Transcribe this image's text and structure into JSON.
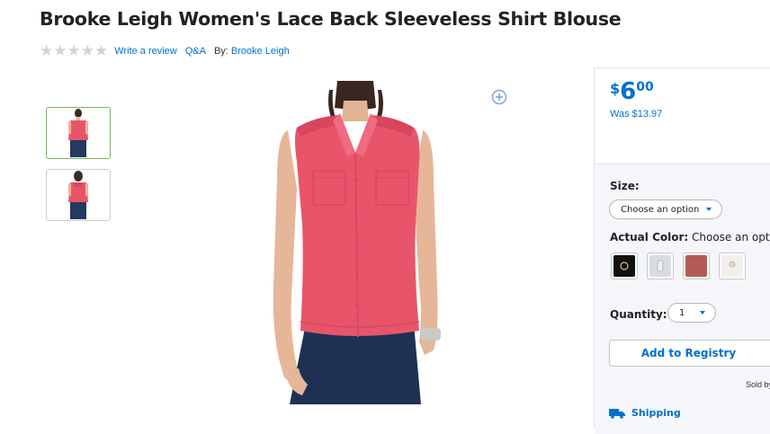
{
  "product": {
    "title": "Brooke Leigh Women's Lace Back Sleeveless Shirt Blouse",
    "rating_stars": 0,
    "write_review": "Write a review",
    "qa": "Q&A",
    "by_label": "By:",
    "brand": "Brooke Leigh"
  },
  "colors": {
    "accent": "#0071ce",
    "star_empty": "#d3d3d3",
    "shirt": "#e8556b",
    "thumb_active_border": "#7ab55c"
  },
  "price": {
    "currency": "$",
    "dollars": "6",
    "cents": "00",
    "was": "Was $13.97"
  },
  "options": {
    "size_label": "Size:",
    "size_select": "Choose an option",
    "color_label": "Actual Color:",
    "color_choose": "Choose an option",
    "swatches": [
      {
        "name": "black",
        "color": "#111111"
      },
      {
        "name": "light-gray",
        "color": "#d9dde2"
      },
      {
        "name": "rose",
        "color": "#b45a55"
      },
      {
        "name": "white",
        "color": "#f2f0ec"
      }
    ],
    "quantity_label": "Quantity:",
    "quantity_value": "1"
  },
  "buttons": {
    "add_to_registry": "Add to Registry"
  },
  "sold_by": "Sold by",
  "shipping": "Shipping",
  "icons": {
    "zoom": "plus-circle-icon",
    "truck": "truck-icon",
    "star": "star-icon"
  }
}
